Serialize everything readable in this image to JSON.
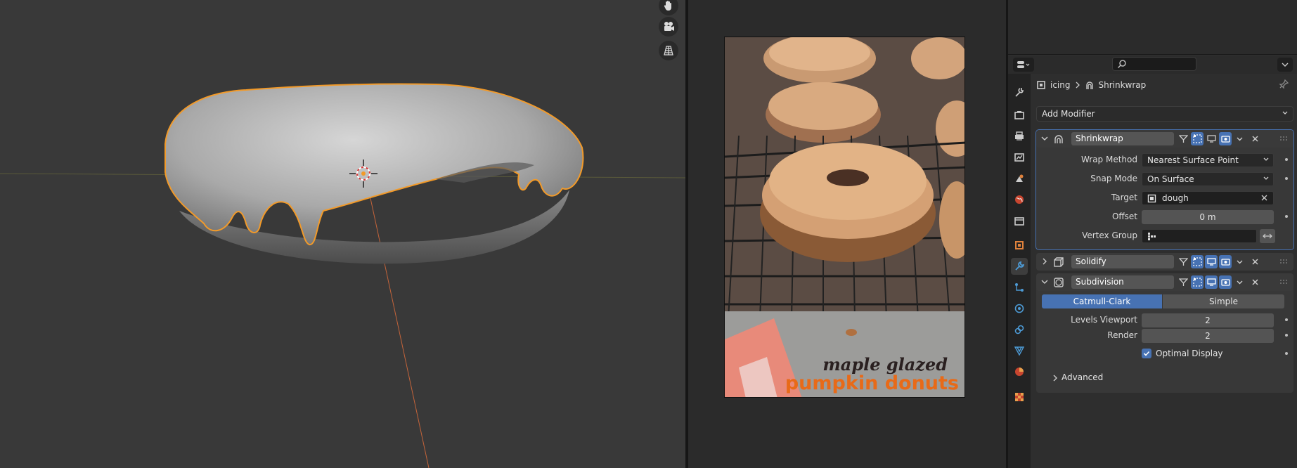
{
  "colors": {
    "accent": "#4772b3",
    "selection_outline": "#f29a29",
    "viewport_bg": "#393939",
    "panel_bg": "#2e2e2e"
  },
  "reference_image": {
    "caption_line1": "maple glazed",
    "caption_line2": "pumpkin donuts"
  },
  "properties": {
    "search": {
      "placeholder": "",
      "value": ""
    },
    "breadcrumb": {
      "object": "icing",
      "modifier": "Shrinkwrap"
    },
    "add_modifier": "Add Modifier",
    "tabs": [
      "tool-icon",
      "render-icon",
      "output-icon",
      "view-layer-icon",
      "scene-icon",
      "world-icon",
      "collection-icon",
      "object-icon",
      "modifier-icon",
      "particles-icon",
      "physics-icon",
      "constraints-icon",
      "data-icon",
      "material-icon",
      "texture-icon"
    ],
    "active_tab": "modifier-icon",
    "modifiers": {
      "shrinkwrap": {
        "name": "Shrinkwrap",
        "wrap_method_label": "Wrap Method",
        "wrap_method": "Nearest Surface Point",
        "snap_mode_label": "Snap Mode",
        "snap_mode": "On Surface",
        "target_label": "Target",
        "target": "dough",
        "offset_label": "Offset",
        "offset": "0 m",
        "vertex_group_label": "Vertex Group",
        "vertex_group": ""
      },
      "solidify": {
        "name": "Solidify"
      },
      "subdivision": {
        "name": "Subdivision",
        "mode_catmull": "Catmull-Clark",
        "mode_simple": "Simple",
        "selected_mode": "Catmull-Clark",
        "levels_viewport_label": "Levels Viewport",
        "levels_viewport": "2",
        "render_label": "Render",
        "render": "2",
        "optimal_display_label": "Optimal Display",
        "optimal_display": true,
        "advanced_label": "Advanced"
      }
    }
  }
}
